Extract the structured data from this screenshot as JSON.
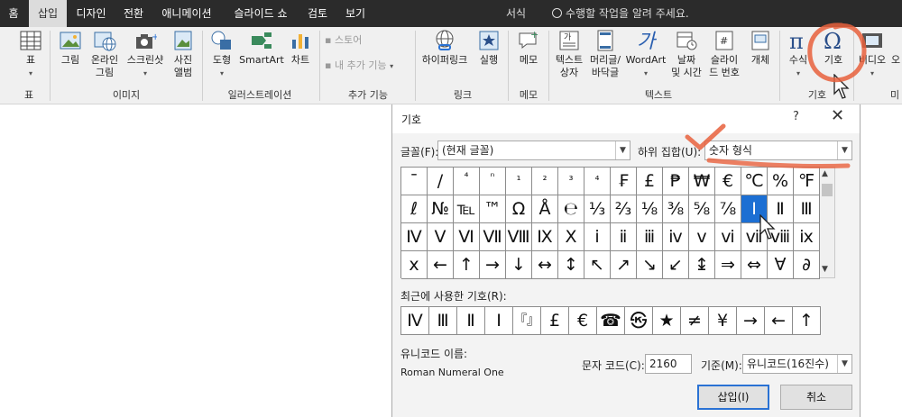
{
  "tabs": [
    {
      "label": "홈"
    },
    {
      "label": "삽입"
    },
    {
      "label": "디자인"
    },
    {
      "label": "전환"
    },
    {
      "label": "애니메이션"
    },
    {
      "label": "슬라이드 쇼"
    },
    {
      "label": "검토"
    },
    {
      "label": "보기"
    },
    {
      "label": "서식"
    }
  ],
  "tell_me": "수행할 작업을 알려 주세요.",
  "ribbon": {
    "table": {
      "label": "표",
      "group": "표"
    },
    "images": {
      "group": "이미지",
      "picture": "그림",
      "online": [
        "온라인",
        "그림"
      ],
      "screenshot": "스크린샷",
      "album": [
        "사진",
        "앨범"
      ]
    },
    "illustrations": {
      "group": "일러스트레이션",
      "shapes": "도형",
      "smartart": "SmartArt",
      "chart": "차트"
    },
    "addins": {
      "group": "추가 기능",
      "store": "스토어",
      "my_addins": "내 추가 기능"
    },
    "links": {
      "group": "링크",
      "hyperlink": "하이퍼링크",
      "action": "실행"
    },
    "comments": {
      "group": "메모",
      "comment": "메모"
    },
    "text": {
      "group": "텍스트",
      "textbox": [
        "텍스트",
        "상자"
      ],
      "header": [
        "머리글/",
        "바닥글"
      ],
      "wordart": "WordArt",
      "datetime": [
        "날짜",
        "및 시간"
      ],
      "slidenum": [
        "슬라이",
        "드 번호"
      ],
      "object": "개체"
    },
    "symbols": {
      "group": "기호",
      "equation": "수식",
      "symbol": "기호"
    },
    "media": {
      "video": "비디오",
      "audio": "오",
      "group": "미"
    }
  },
  "dialog": {
    "title": "기호",
    "help": "?",
    "close": "✕",
    "font_label": "글꼴(F):",
    "font_value": "(현재 글꼴)",
    "subset_label": "하위 집합(U):",
    "subset_value": "숫자 형식",
    "grid": [
      [
        "¯",
        "/",
        "⁴",
        "ⁿ",
        "₁",
        "₂",
        "₃",
        "₄",
        "₣",
        "£",
        "₱",
        "₩",
        "€",
        "℃",
        "%",
        "℉"
      ],
      [
        "ℓ",
        "№",
        "℡",
        "™",
        "Ω",
        "Å",
        "℮",
        "⅓",
        "⅔",
        "⅛",
        "⅜",
        "⅝",
        "⅞",
        "Ⅰ",
        "Ⅱ",
        "Ⅲ"
      ],
      [
        "Ⅳ",
        "Ⅴ",
        "Ⅵ",
        "Ⅶ",
        "Ⅷ",
        "Ⅸ",
        "Ⅹ",
        "ⅰ",
        "ⅱ",
        "ⅲ",
        "ⅳ",
        "ⅴ",
        "ⅵ",
        "ⅶ",
        "ⅷ",
        "ⅸ"
      ],
      [
        "ⅹ",
        "←",
        "↑",
        "→",
        "↓",
        "↔",
        "↕",
        "↖",
        "↗",
        "↘",
        "↙",
        "↨",
        "⇒",
        "⇔",
        "∀",
        "∂"
      ]
    ],
    "selected": {
      "row": 1,
      "col": 13
    },
    "recent_label": "최근에 사용한 기호(R):",
    "recent": [
      "Ⅳ",
      "Ⅲ",
      "Ⅱ",
      "Ⅰ",
      "『』",
      "£",
      "€",
      "☎",
      "㉿",
      "★",
      "≠",
      "¥",
      "→",
      "←",
      "↑"
    ],
    "unicode_name_label": "유니코드 이름:",
    "unicode_name": "Roman Numeral One",
    "char_code_label": "문자 코드(C):",
    "char_code": "2160",
    "from_label": "기준(M):",
    "from_value": "유니코드(16진수)",
    "insert": "삽입(I)",
    "cancel": "취소"
  },
  "colors": {
    "accent": "#1c6fd3",
    "annotation": "#e8603c",
    "tabbar": "#2b2b2b"
  }
}
